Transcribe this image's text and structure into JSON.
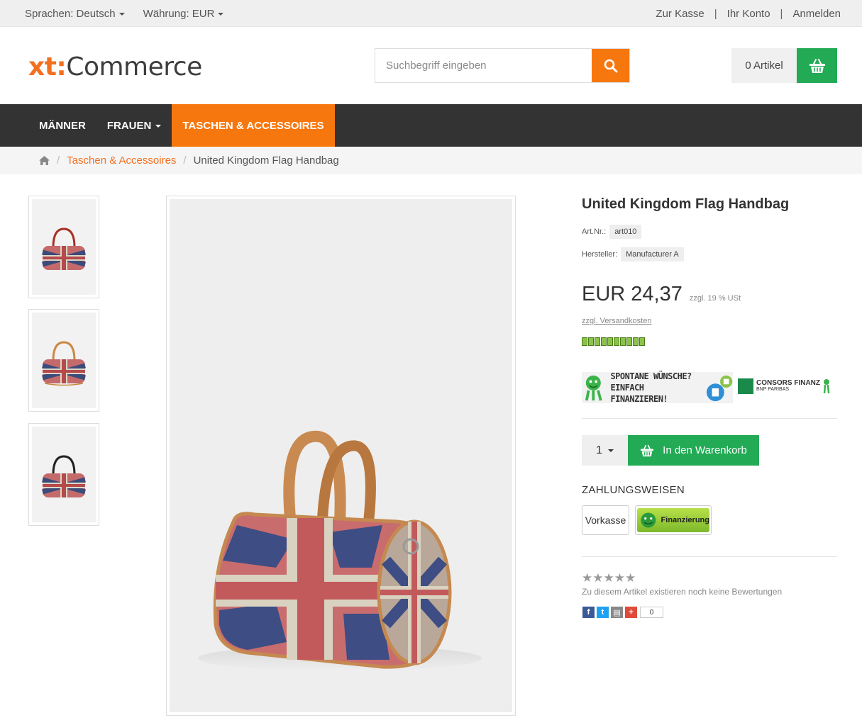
{
  "topbar": {
    "language": "Sprachen: Deutsch",
    "currency": "Währung: EUR",
    "checkout": "Zur Kasse",
    "account": "Ihr Konto",
    "login": "Anmelden",
    "separator": "|"
  },
  "header": {
    "logo_xt": "xt:",
    "logo_commerce": "Commerce",
    "search_placeholder": "Suchbegriff eingeben",
    "cart_count": "0 Artikel"
  },
  "nav": {
    "items": [
      {
        "label": "Männer"
      },
      {
        "label": "Frauen"
      },
      {
        "label": "Taschen & Accessoires"
      }
    ]
  },
  "breadcrumb": {
    "category": "Taschen & Accessoires",
    "current": "United Kingdom Flag Handbag",
    "separator": "/"
  },
  "product": {
    "title": "United Kingdom Flag Handbag",
    "sku_label": "Art.Nr.:",
    "sku": "art010",
    "manufacturer_label": "Hersteller:",
    "manufacturer": "Manufacturer A",
    "price": "EUR 24,37",
    "tax_note": "zzgl. 19 % USt",
    "shipping": "zzgl. Versandkosten",
    "quantity": "1",
    "add_to_cart": "In den Warenkorb",
    "payment_heading": "ZAHLUNGSWEISEN",
    "payment_vorkasse": "Vorkasse",
    "payment_finanzierung": "Finanzierung",
    "banner_text_1": "SPONTANE WÜNSCHE?",
    "banner_text_2": "EINFACH FINANZIEREN!",
    "consors_name": "CONSORS FINANZ",
    "consors_sub": "BNP PARIBAS",
    "stars": "★★★★★",
    "rating_count": 0,
    "no_reviews": "Zu diesem Artikel existieren noch keine Bewertungen",
    "share_count": "0"
  },
  "colors": {
    "accent": "#f7770f",
    "green": "#22aa55",
    "nav_bg": "#333333"
  }
}
